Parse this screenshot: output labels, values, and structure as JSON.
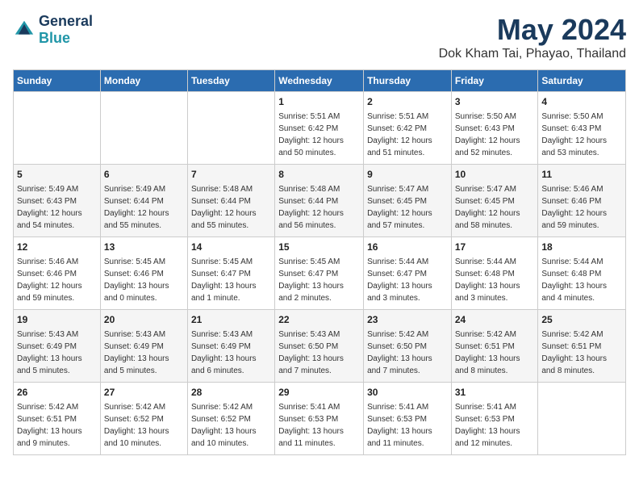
{
  "header": {
    "logo_line1": "General",
    "logo_line2": "Blue",
    "month": "May 2024",
    "location": "Dok Kham Tai, Phayao, Thailand"
  },
  "weekdays": [
    "Sunday",
    "Monday",
    "Tuesday",
    "Wednesday",
    "Thursday",
    "Friday",
    "Saturday"
  ],
  "weeks": [
    [
      {
        "day": "",
        "info": ""
      },
      {
        "day": "",
        "info": ""
      },
      {
        "day": "",
        "info": ""
      },
      {
        "day": "1",
        "info": "Sunrise: 5:51 AM\nSunset: 6:42 PM\nDaylight: 12 hours\nand 50 minutes."
      },
      {
        "day": "2",
        "info": "Sunrise: 5:51 AM\nSunset: 6:42 PM\nDaylight: 12 hours\nand 51 minutes."
      },
      {
        "day": "3",
        "info": "Sunrise: 5:50 AM\nSunset: 6:43 PM\nDaylight: 12 hours\nand 52 minutes."
      },
      {
        "day": "4",
        "info": "Sunrise: 5:50 AM\nSunset: 6:43 PM\nDaylight: 12 hours\nand 53 minutes."
      }
    ],
    [
      {
        "day": "5",
        "info": "Sunrise: 5:49 AM\nSunset: 6:43 PM\nDaylight: 12 hours\nand 54 minutes."
      },
      {
        "day": "6",
        "info": "Sunrise: 5:49 AM\nSunset: 6:44 PM\nDaylight: 12 hours\nand 55 minutes."
      },
      {
        "day": "7",
        "info": "Sunrise: 5:48 AM\nSunset: 6:44 PM\nDaylight: 12 hours\nand 55 minutes."
      },
      {
        "day": "8",
        "info": "Sunrise: 5:48 AM\nSunset: 6:44 PM\nDaylight: 12 hours\nand 56 minutes."
      },
      {
        "day": "9",
        "info": "Sunrise: 5:47 AM\nSunset: 6:45 PM\nDaylight: 12 hours\nand 57 minutes."
      },
      {
        "day": "10",
        "info": "Sunrise: 5:47 AM\nSunset: 6:45 PM\nDaylight: 12 hours\nand 58 minutes."
      },
      {
        "day": "11",
        "info": "Sunrise: 5:46 AM\nSunset: 6:46 PM\nDaylight: 12 hours\nand 59 minutes."
      }
    ],
    [
      {
        "day": "12",
        "info": "Sunrise: 5:46 AM\nSunset: 6:46 PM\nDaylight: 12 hours\nand 59 minutes."
      },
      {
        "day": "13",
        "info": "Sunrise: 5:45 AM\nSunset: 6:46 PM\nDaylight: 13 hours\nand 0 minutes."
      },
      {
        "day": "14",
        "info": "Sunrise: 5:45 AM\nSunset: 6:47 PM\nDaylight: 13 hours\nand 1 minute."
      },
      {
        "day": "15",
        "info": "Sunrise: 5:45 AM\nSunset: 6:47 PM\nDaylight: 13 hours\nand 2 minutes."
      },
      {
        "day": "16",
        "info": "Sunrise: 5:44 AM\nSunset: 6:47 PM\nDaylight: 13 hours\nand 3 minutes."
      },
      {
        "day": "17",
        "info": "Sunrise: 5:44 AM\nSunset: 6:48 PM\nDaylight: 13 hours\nand 3 minutes."
      },
      {
        "day": "18",
        "info": "Sunrise: 5:44 AM\nSunset: 6:48 PM\nDaylight: 13 hours\nand 4 minutes."
      }
    ],
    [
      {
        "day": "19",
        "info": "Sunrise: 5:43 AM\nSunset: 6:49 PM\nDaylight: 13 hours\nand 5 minutes."
      },
      {
        "day": "20",
        "info": "Sunrise: 5:43 AM\nSunset: 6:49 PM\nDaylight: 13 hours\nand 5 minutes."
      },
      {
        "day": "21",
        "info": "Sunrise: 5:43 AM\nSunset: 6:49 PM\nDaylight: 13 hours\nand 6 minutes."
      },
      {
        "day": "22",
        "info": "Sunrise: 5:43 AM\nSunset: 6:50 PM\nDaylight: 13 hours\nand 7 minutes."
      },
      {
        "day": "23",
        "info": "Sunrise: 5:42 AM\nSunset: 6:50 PM\nDaylight: 13 hours\nand 7 minutes."
      },
      {
        "day": "24",
        "info": "Sunrise: 5:42 AM\nSunset: 6:51 PM\nDaylight: 13 hours\nand 8 minutes."
      },
      {
        "day": "25",
        "info": "Sunrise: 5:42 AM\nSunset: 6:51 PM\nDaylight: 13 hours\nand 8 minutes."
      }
    ],
    [
      {
        "day": "26",
        "info": "Sunrise: 5:42 AM\nSunset: 6:51 PM\nDaylight: 13 hours\nand 9 minutes."
      },
      {
        "day": "27",
        "info": "Sunrise: 5:42 AM\nSunset: 6:52 PM\nDaylight: 13 hours\nand 10 minutes."
      },
      {
        "day": "28",
        "info": "Sunrise: 5:42 AM\nSunset: 6:52 PM\nDaylight: 13 hours\nand 10 minutes."
      },
      {
        "day": "29",
        "info": "Sunrise: 5:41 AM\nSunset: 6:53 PM\nDaylight: 13 hours\nand 11 minutes."
      },
      {
        "day": "30",
        "info": "Sunrise: 5:41 AM\nSunset: 6:53 PM\nDaylight: 13 hours\nand 11 minutes."
      },
      {
        "day": "31",
        "info": "Sunrise: 5:41 AM\nSunset: 6:53 PM\nDaylight: 13 hours\nand 12 minutes."
      },
      {
        "day": "",
        "info": ""
      }
    ]
  ]
}
